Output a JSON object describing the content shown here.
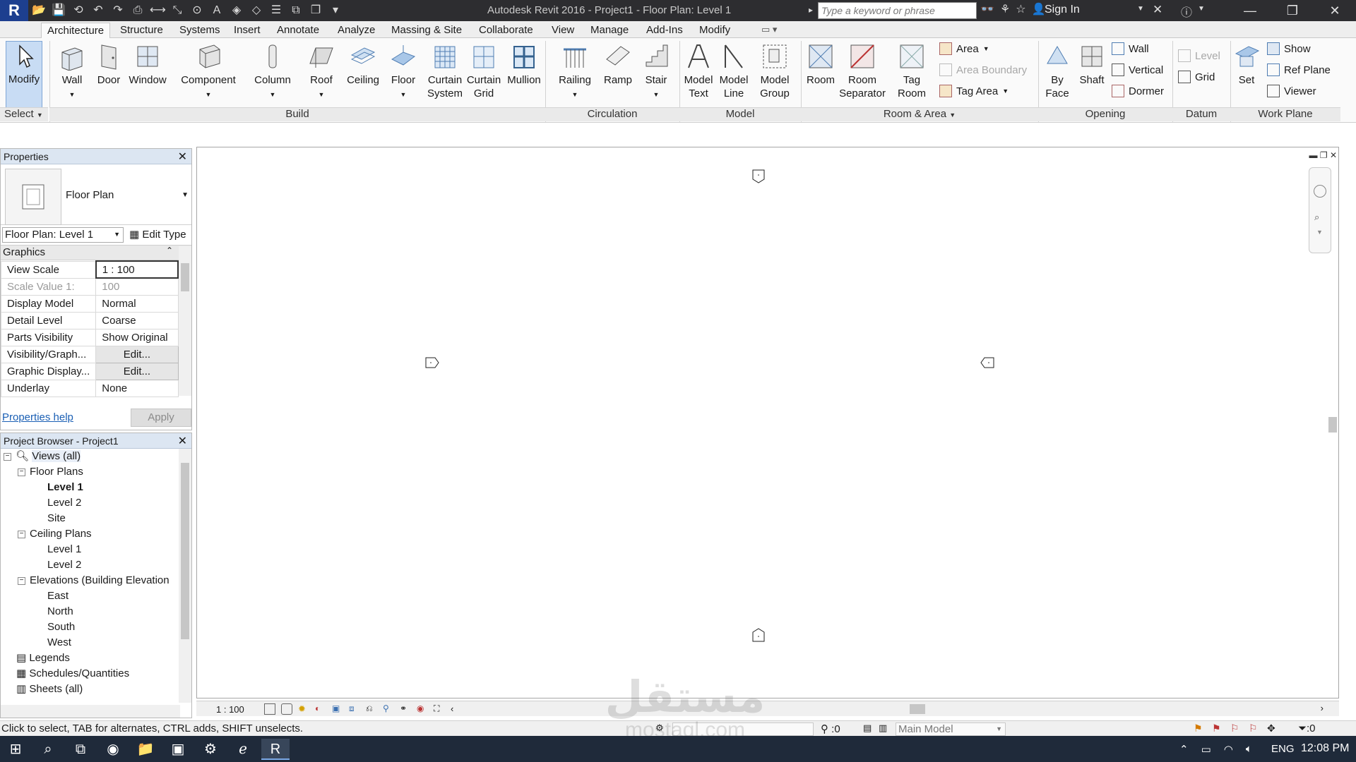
{
  "title_bar": {
    "app_logo": "R",
    "app_title": "Autodesk Revit 2016 -   Project1 - Floor Plan: Level 1",
    "search_placeholder": "Type a keyword or phrase",
    "sign_in_label": "Sign In"
  },
  "ribbon": {
    "tabs": [
      "Architecture",
      "Structure",
      "Systems",
      "Insert",
      "Annotate",
      "Analyze",
      "Massing & Site",
      "Collaborate",
      "View",
      "Manage",
      "Add-Ins",
      "Modify"
    ],
    "active_tab": "Architecture",
    "modify": "Modify",
    "select": "Select",
    "build": {
      "label": "Build",
      "buttons": [
        "Wall",
        "Door",
        "Window",
        "Component",
        "Column",
        "Roof",
        "Ceiling",
        "Floor",
        "Curtain System",
        "Curtain Grid",
        "Mullion"
      ]
    },
    "circulation": {
      "label": "Circulation",
      "buttons": [
        "Railing",
        "Ramp",
        "Stair"
      ]
    },
    "model": {
      "label": "Model",
      "buttons": [
        "Model Text",
        "Model Line",
        "Model Group"
      ]
    },
    "room_area": {
      "label": "Room & Area",
      "buttons": [
        "Room",
        "Room Separator",
        "Tag Room"
      ],
      "small": {
        "area": "Area",
        "area_boundary": "Area  Boundary",
        "tag_area": "Tag  Area"
      }
    },
    "opening": {
      "label": "Opening",
      "buttons": [
        "By Face",
        "Shaft"
      ],
      "small": {
        "wall": "Wall",
        "vertical": "Vertical",
        "dormer": "Dormer"
      }
    },
    "datum": {
      "label": "Datum",
      "level": "Level",
      "grid": "Grid"
    },
    "work_plane": {
      "label": "Work Plane",
      "set": "Set",
      "show": "Show",
      "ref_plane": "Ref  Plane",
      "viewer": "Viewer"
    }
  },
  "properties": {
    "title": "Properties",
    "type_name": "Floor Plan",
    "instance_selector": "Floor Plan: Level 1",
    "edit_type": "Edit Type",
    "group": "Graphics",
    "rows": [
      {
        "label": "View Scale",
        "value": "1 : 100"
      },
      {
        "label": "Scale Value    1:",
        "value": "100"
      },
      {
        "label": "Display Model",
        "value": "Normal"
      },
      {
        "label": "Detail Level",
        "value": "Coarse"
      },
      {
        "label": "Parts Visibility",
        "value": "Show Original"
      },
      {
        "label": "Visibility/Graph...",
        "value": "Edit..."
      },
      {
        "label": "Graphic Display...",
        "value": "Edit..."
      },
      {
        "label": "Underlay",
        "value": "None"
      }
    ],
    "help_link": "Properties help",
    "apply": "Apply"
  },
  "project_browser": {
    "title": "Project Browser - Project1",
    "nodes": [
      {
        "label": "Views (all)"
      },
      {
        "label": "Floor Plans"
      },
      {
        "label": "Level 1"
      },
      {
        "label": "Level 2"
      },
      {
        "label": "Site"
      },
      {
        "label": "Ceiling Plans"
      },
      {
        "label": "Level 1"
      },
      {
        "label": "Level 2"
      },
      {
        "label": "Elevations (Building Elevation"
      },
      {
        "label": "East"
      },
      {
        "label": "North"
      },
      {
        "label": "South"
      },
      {
        "label": "West"
      },
      {
        "label": "Legends"
      },
      {
        "label": "Schedules/Quantities"
      },
      {
        "label": "Sheets (all)"
      }
    ]
  },
  "view_control_bar": {
    "scale": "1 : 100"
  },
  "status_bar": {
    "message": "Click to select, TAB for alternates, CTRL adds, SHIFT unselects.",
    "selection_count": ":0",
    "active_model": "Main Model",
    "filter_count": ":0"
  },
  "taskbar": {
    "language": "ENG",
    "time": "12:08 PM"
  },
  "watermark": {
    "arabic": "مستقل",
    "latin": "mostaql.com"
  }
}
